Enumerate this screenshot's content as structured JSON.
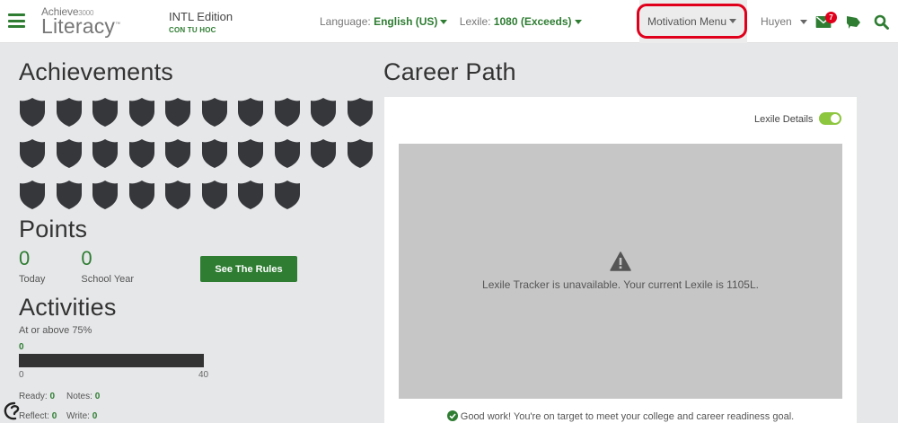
{
  "header": {
    "brand_top": "Achieve",
    "brand_top_num": "3000",
    "brand_main": "Literacy",
    "edition_title": "INTL Edition",
    "edition_sub": "CON TU HOC",
    "language_label": "Language:",
    "language_value": "English (US)",
    "lexile_label": "Lexile:",
    "lexile_value": "1080 (Exceeds)",
    "motivation_menu": "Motivation Menu",
    "user_name": "Huyen",
    "mail_count": "7"
  },
  "achievements": {
    "title": "Achievements",
    "shield_count": 28
  },
  "points": {
    "title": "Points",
    "today_value": "0",
    "today_label": "Today",
    "year_value": "0",
    "year_label": "School Year",
    "rules_button": "See The Rules"
  },
  "activities": {
    "title": "Activities",
    "subtitle": "At or above 75%",
    "bar_value": "0",
    "bar_min": "0",
    "bar_max": "40",
    "ready_label": "Ready:",
    "ready_value": "0",
    "notes_label": "Notes:",
    "notes_value": "0",
    "reflect_label": "Reflect:",
    "reflect_value": "0",
    "write_label": "Write:",
    "write_value": "0"
  },
  "career": {
    "title": "Career Path",
    "lexile_details": "Lexile Details",
    "tracker_message": "Lexile Tracker is unavailable. Your current Lexile is 1105L.",
    "goal_message": "Good work! You're on target to meet your college and career readiness goal."
  }
}
